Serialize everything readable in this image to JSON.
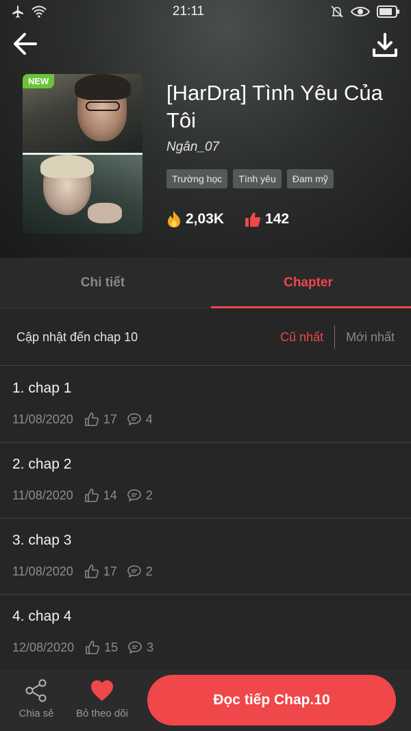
{
  "status_bar": {
    "time": "21:11"
  },
  "header": {
    "badge": "NEW",
    "title": "[HarDra] Tình Yêu Của Tôi",
    "author": "Ngân_07",
    "tags": [
      "Trường học",
      "Tình yêu",
      "Đam mỹ"
    ],
    "views": "2,03K",
    "likes": "142"
  },
  "tabs": [
    {
      "label": "Chi tiết",
      "active": false
    },
    {
      "label": "Chapter",
      "active": true
    }
  ],
  "update": {
    "text": "Cập nhật đến chap 10",
    "sort_oldest": "Cũ nhất",
    "sort_newest": "Mới nhất"
  },
  "chapters": [
    {
      "title": "1. chap 1",
      "date": "11/08/2020",
      "likes": "17",
      "comments": "4"
    },
    {
      "title": "2. chap 2",
      "date": "11/08/2020",
      "likes": "14",
      "comments": "2"
    },
    {
      "title": "3. chap 3",
      "date": "11/08/2020",
      "likes": "17",
      "comments": "2"
    },
    {
      "title": "4. chap 4",
      "date": "12/08/2020",
      "likes": "15",
      "comments": "3"
    }
  ],
  "bottom_bar": {
    "share_label": "Chia sẻ",
    "unfollow_label": "Bỏ theo dõi",
    "read_label": "Đọc tiếp Chap.10"
  },
  "colors": {
    "accent": "#f0474a",
    "background": "#262626",
    "new_badge": "#6ac33a"
  }
}
